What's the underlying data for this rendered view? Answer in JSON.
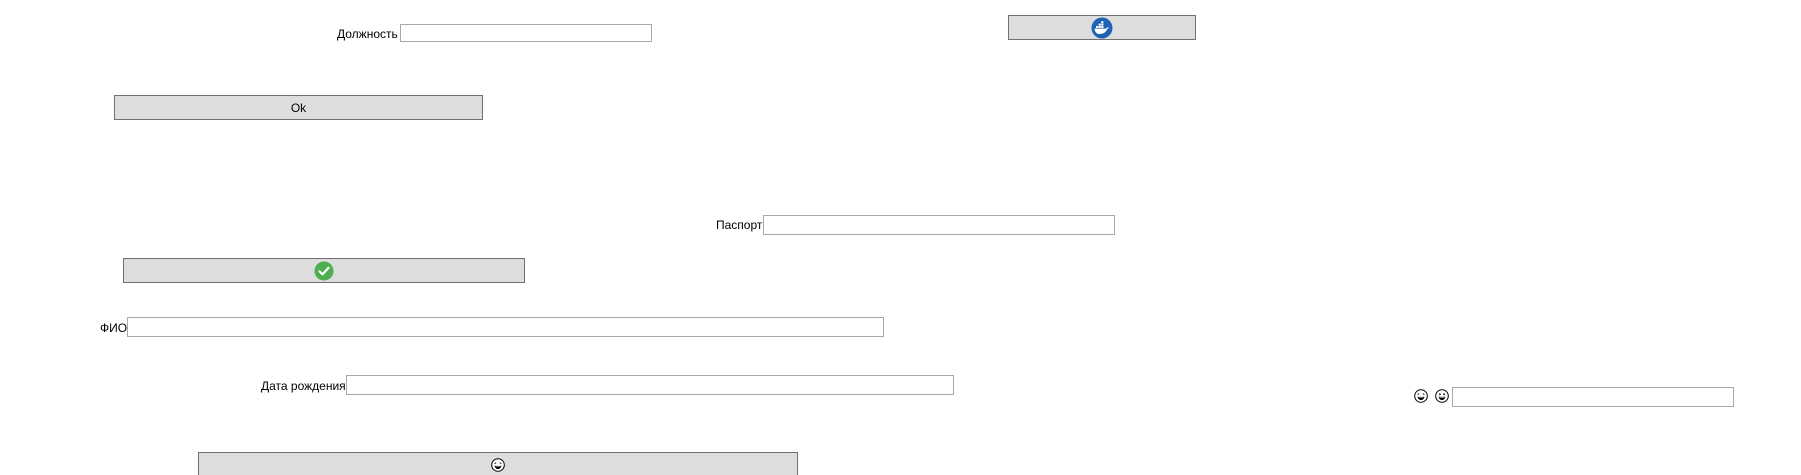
{
  "fields": {
    "position_label": "Должность",
    "passport_label": "Паспорт",
    "fio_label": "ФИО",
    "birthdate_label": "Дата рождения",
    "position_value": "",
    "passport_value": "",
    "fio_value": "",
    "birthdate_value": "",
    "emoji_field_value": ""
  },
  "buttons": {
    "ok_label": "Ok",
    "docker_icon": "docker-whale-icon",
    "check_icon": "check-circle-icon",
    "bottom_icon": "laughing-face-icon"
  },
  "emoji_labels": {
    "first_icon": "laughing-face-icon",
    "second_icon": "grinning-face-icon"
  },
  "colors": {
    "button_bg": "#dddddd",
    "button_border": "#707070",
    "field_border": "#a9a9a9",
    "docker_blue": "#1d63b5",
    "check_green": "#4caf50"
  }
}
